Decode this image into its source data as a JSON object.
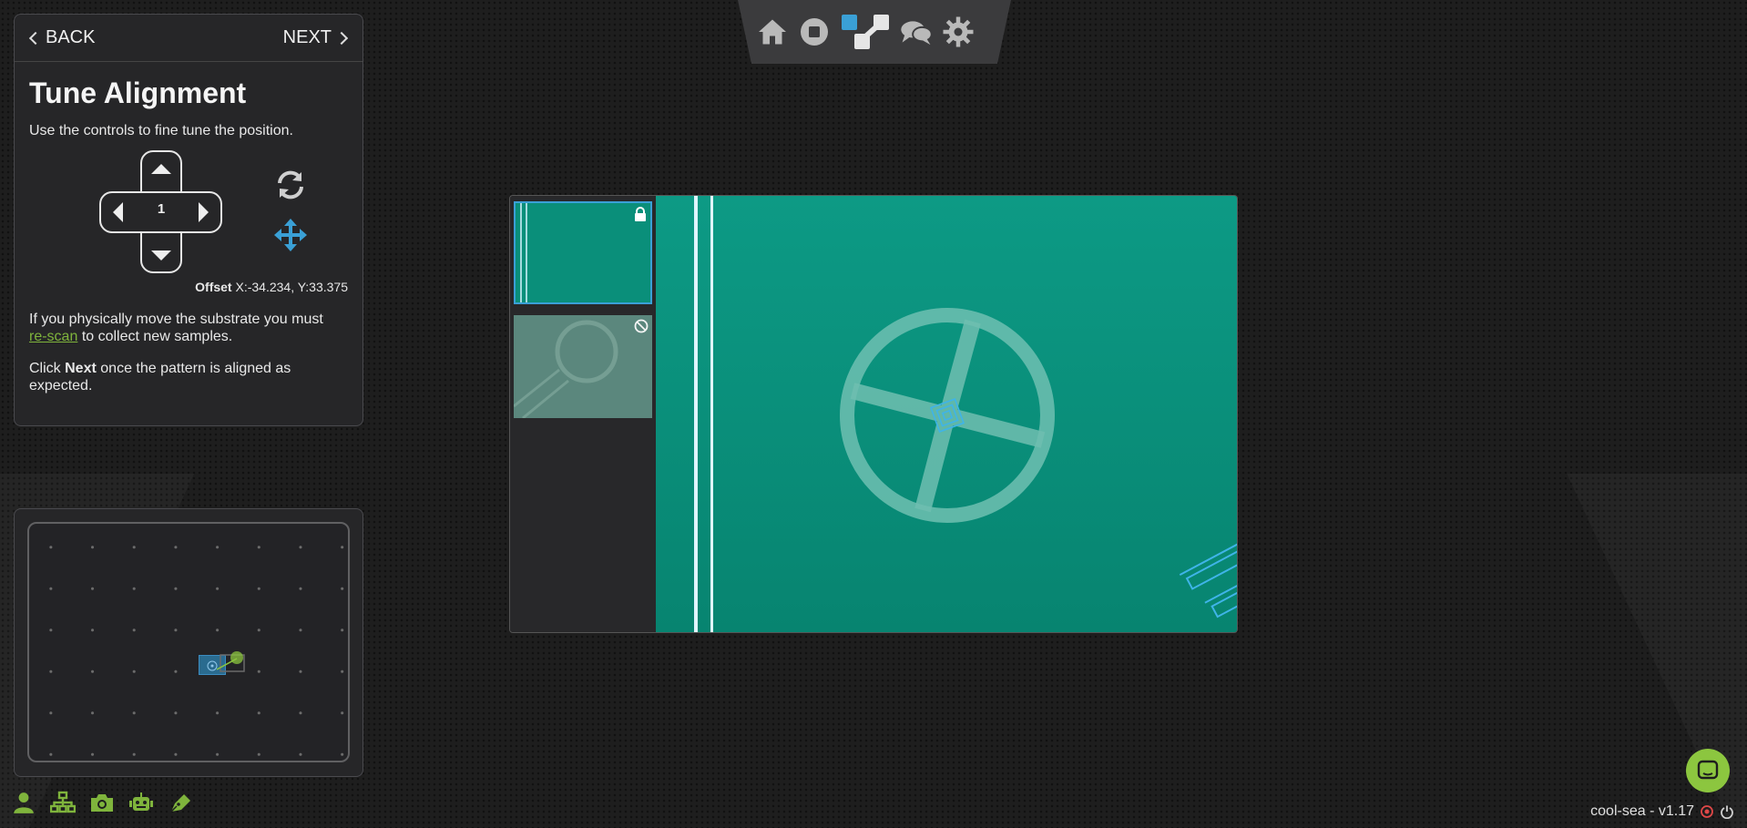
{
  "nav": {
    "back_label": "BACK",
    "next_label": "NEXT"
  },
  "panel": {
    "title": "Tune Alignment",
    "subtitle": "Use the controls to fine tune the position.",
    "step_value": "1",
    "offset_label": "Offset",
    "offset_value": "X:-34.234, Y:33.375",
    "para1_before": "If you physically move the substrate you must",
    "para1_link": "re-scan",
    "para1_after": "to collect new samples.",
    "para2_before": "Click",
    "para2_bold": "Next",
    "para2_after": "once the pattern is aligned as expected."
  },
  "top_nav": {
    "icons": [
      "home-icon",
      "stop-icon",
      "workflow-icon",
      "chat-icon",
      "gear-icon"
    ],
    "active": "workflow-icon"
  },
  "bottom_tools": {
    "icons": [
      "user-icon",
      "network-icon",
      "camera-icon",
      "robot-icon",
      "pen-icon"
    ],
    "color": "#7fb43c"
  },
  "viewer": {
    "thumb1_status": "lock-icon",
    "thumb2_status": "disabled-icon"
  },
  "footer": {
    "version": "cool-sea - v1.17"
  },
  "colors": {
    "accent_blue": "#3aa0d6",
    "accent_green": "#8cc63f",
    "substrate_teal": "#0b8f7b",
    "status_red": "#e04848"
  }
}
